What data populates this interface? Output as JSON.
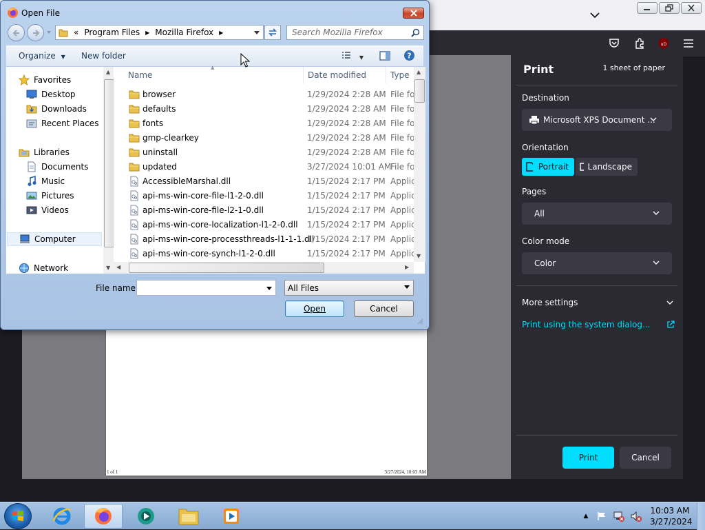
{
  "dialog": {
    "title": "Open File",
    "breadcrumb": [
      "«",
      "Program Files",
      "Mozilla Firefox"
    ],
    "search_placeholder": "Search Mozilla Firefox",
    "toolbar": {
      "organize": "Organize",
      "new_folder": "New folder"
    },
    "nav": {
      "favorites": "Favorites",
      "favorites_items": [
        "Desktop",
        "Downloads",
        "Recent Places"
      ],
      "libraries": "Libraries",
      "libraries_items": [
        "Documents",
        "Music",
        "Pictures",
        "Videos"
      ],
      "computer": "Computer",
      "network": "Network"
    },
    "columns": {
      "name": "Name",
      "date": "Date modified",
      "type": "Type"
    },
    "files": [
      {
        "name": "browser",
        "date": "1/29/2024 2:28 AM",
        "type": "File folder",
        "kind": "folder"
      },
      {
        "name": "defaults",
        "date": "1/29/2024 2:28 AM",
        "type": "File folder",
        "kind": "folder"
      },
      {
        "name": "fonts",
        "date": "1/29/2024 2:28 AM",
        "type": "File folder",
        "kind": "folder"
      },
      {
        "name": "gmp-clearkey",
        "date": "1/29/2024 2:28 AM",
        "type": "File folder",
        "kind": "folder"
      },
      {
        "name": "uninstall",
        "date": "1/29/2024 2:28 AM",
        "type": "File folder",
        "kind": "folder"
      },
      {
        "name": "updated",
        "date": "3/27/2024 10:01 AM",
        "type": "File folder",
        "kind": "folder"
      },
      {
        "name": "AccessibleMarshal.dll",
        "date": "1/15/2024 2:17 PM",
        "type": "Application extension",
        "kind": "dll"
      },
      {
        "name": "api-ms-win-core-file-l1-2-0.dll",
        "date": "1/15/2024 2:17 PM",
        "type": "Application extension",
        "kind": "dll"
      },
      {
        "name": "api-ms-win-core-file-l2-1-0.dll",
        "date": "1/15/2024 2:17 PM",
        "type": "Application extension",
        "kind": "dll"
      },
      {
        "name": "api-ms-win-core-localization-l1-2-0.dll",
        "date": "1/15/2024 2:17 PM",
        "type": "Application extension",
        "kind": "dll"
      },
      {
        "name": "api-ms-win-core-processthreads-l1-1-1.dll",
        "date": "1/15/2024 2:17 PM",
        "type": "Application extension",
        "kind": "dll"
      },
      {
        "name": "api-ms-win-core-synch-l1-2-0.dll",
        "date": "1/15/2024 2:17 PM",
        "type": "Application extension",
        "kind": "dll"
      }
    ],
    "file_name_label": "File name:",
    "file_name_value": "",
    "file_type": "All Files",
    "open_button": "Open",
    "cancel_button": "Cancel"
  },
  "print": {
    "title": "Print",
    "sheets": "1 sheet of paper",
    "destination_label": "Destination",
    "destination_value": "Microsoft XPS Document ...",
    "orientation_label": "Orientation",
    "portrait": "Portrait",
    "landscape": "Landscape",
    "pages_label": "Pages",
    "pages_value": "All",
    "color_label": "Color mode",
    "color_value": "Color",
    "more_settings": "More settings",
    "system_dialog_link": "Print using the system dialog...",
    "print_button": "Print",
    "cancel_button": "Cancel",
    "accent": "#00ddff"
  },
  "preview": {
    "page_count": "1 of 1",
    "timestamp": "3/27/2024, 10:03 AM"
  },
  "taskbar": {
    "time": "10:03 AM",
    "date": "3/27/2024"
  }
}
